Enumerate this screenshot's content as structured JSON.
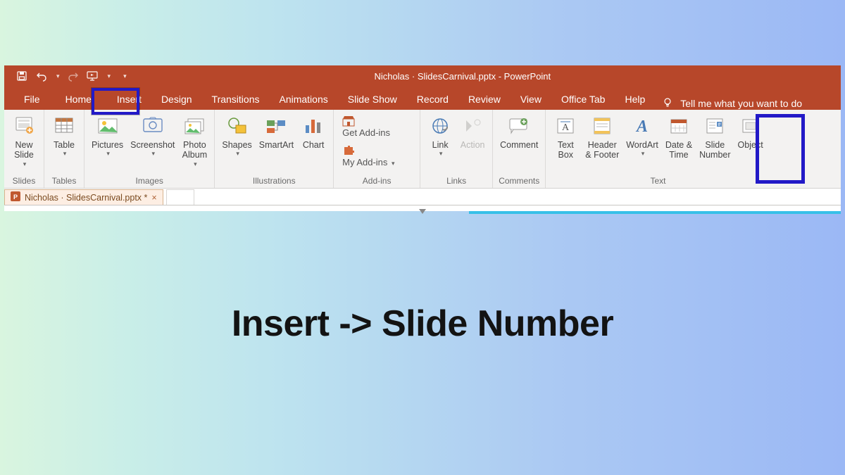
{
  "title": "Nicholas · SlidesCarnival.pptx  -  PowerPoint",
  "tabs": {
    "file": "File",
    "home": "Home",
    "insert": "Insert",
    "design": "Design",
    "transitions": "Transitions",
    "animations": "Animations",
    "slide_show": "Slide Show",
    "record": "Record",
    "review": "Review",
    "view": "View",
    "office_tab": "Office Tab",
    "help": "Help"
  },
  "tell_me": "Tell me what you want to do",
  "groups": {
    "slides": "Slides",
    "tables": "Tables",
    "images": "Images",
    "illustrations": "Illustrations",
    "addins": "Add-ins",
    "links": "Links",
    "comments": "Comments",
    "text": "Text"
  },
  "btn": {
    "new_slide": "New\nSlide",
    "table": "Table",
    "pictures": "Pictures",
    "screenshot": "Screenshot",
    "photo_album": "Photo\nAlbum",
    "shapes": "Shapes",
    "smartart": "SmartArt",
    "chart": "Chart",
    "get_addins": "Get Add-ins",
    "my_addins": "My Add-ins",
    "link": "Link",
    "action": "Action",
    "comment": "Comment",
    "text_box": "Text\nBox",
    "header_footer": "Header\n& Footer",
    "wordart": "WordArt",
    "date_time": "Date &\nTime",
    "slide_number": "Slide\nNumber",
    "object": "Object"
  },
  "doc_tab": "Nicholas · SlidesCarnival.pptx *",
  "instruction": "Insert -> Slide Number"
}
